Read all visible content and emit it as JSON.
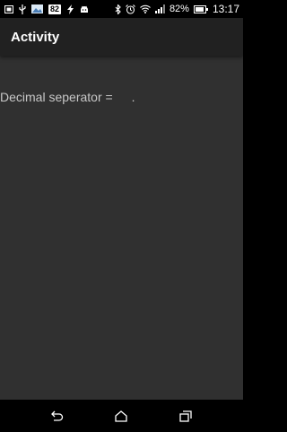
{
  "status_bar": {
    "left_icons": [
      "sim-icon",
      "usb-icon",
      "image-icon",
      "notification-badge",
      "flash-icon",
      "android-icon"
    ],
    "badge_text": "82",
    "right_icons": [
      "bluetooth-icon",
      "alarm-icon",
      "wifi-icon",
      "signal-icon",
      "battery-icon"
    ],
    "battery_percent": "82%",
    "time": "13:17"
  },
  "app_bar": {
    "title": "Activity"
  },
  "content": {
    "decimal_label": "Decimal seperator =",
    "decimal_value": "."
  },
  "nav_bar": {
    "buttons": [
      "back-icon",
      "home-icon",
      "recents-icon"
    ]
  },
  "colors": {
    "background": "#303030",
    "app_bar": "#212121",
    "status_bar": "#000000",
    "text": "#c8c8c8"
  }
}
